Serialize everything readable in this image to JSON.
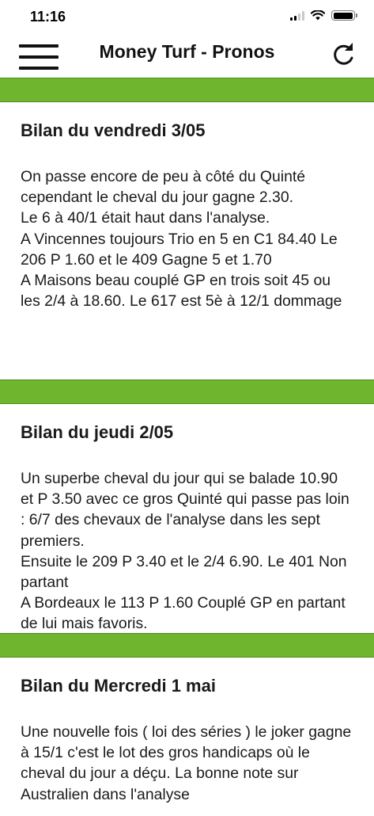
{
  "status_bar": {
    "time": "11:16",
    "icons": [
      "signal-icon",
      "wifi-icon",
      "battery-icon"
    ]
  },
  "header": {
    "title": "Money Turf - Pronos",
    "menu_icon": "hamburger-menu-icon",
    "refresh_icon": "refresh-icon"
  },
  "colors": {
    "accent_green": "#6fb52e",
    "text": "#1a1a1a",
    "background": "#ffffff"
  },
  "posts": [
    {
      "title": "Bilan du vendredi 3/05",
      "body": "On passe encore de peu à côté du Quinté cependant le cheval du jour gagne 2.30.\nLe 6 à 40/1 était haut dans l'analyse.\nA Vincennes toujours Trio en 5 en C1 84.40 Le 206 P 1.60 et le 409 Gagne 5 et 1.70\nA Maisons beau couplé GP en trois soit 45 ou les 2/4 à 18.60. Le 617 est 5è à 12/1 dommage"
    },
    {
      "title": "Bilan du jeudi 2/05",
      "body": "Un superbe cheval du jour qui se balade 10.90 et P 3.50 avec ce gros Quinté qui passe pas loin : 6/7 des chevaux de l'analyse dans les sept premiers.\nEnsuite le 209 P 3.40 et le 2/4 6.90. Le 401 Non partant\nA Bordeaux  le 113 P 1.60 Couplé GP en partant de lui mais favoris."
    },
    {
      "title": "Bilan du Mercredi 1 mai",
      "body": "Une nouvelle fois ( loi des séries )  le joker gagne à 15/1  c'est le lot des gros handicaps où le cheval du jour a déçu. La bonne note sur Australien dans l'analyse"
    }
  ]
}
